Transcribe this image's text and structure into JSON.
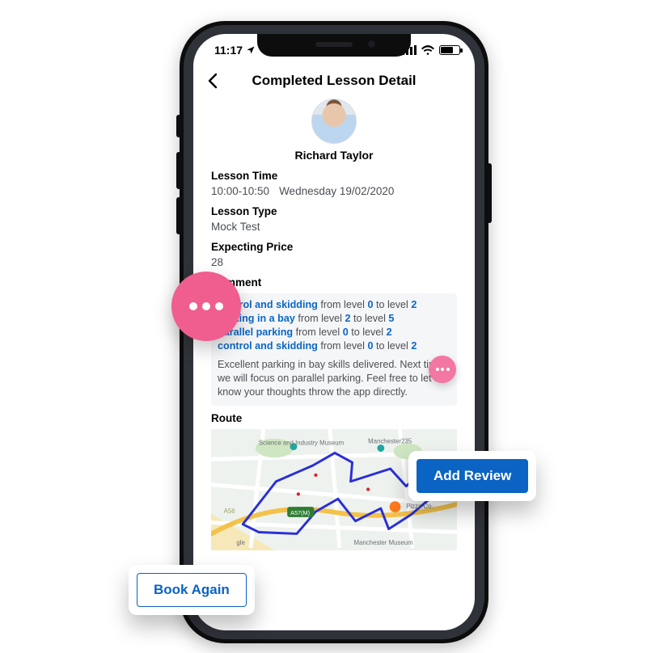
{
  "statusbar": {
    "time": "11:17"
  },
  "header": {
    "title": "Completed Lesson Detail"
  },
  "instructor": {
    "name": "Richard Taylor"
  },
  "labels": {
    "lesson_time": "Lesson Time",
    "lesson_type": "Lesson Type",
    "expecting_price": "Expecting Price",
    "comment": "Comment",
    "route": "Route"
  },
  "lesson": {
    "time_range": "10:00-10:50",
    "day_date": "Wednesday 19/02/2020",
    "type": "Mock Test",
    "price": "28"
  },
  "skills": [
    {
      "name": "control and skidding",
      "from": "0",
      "to": "2"
    },
    {
      "name": "parking in a bay",
      "from": "2",
      "to": "5"
    },
    {
      "name": "parallel parking",
      "from": "0",
      "to": "2"
    },
    {
      "name": "control and skidding",
      "from": "0",
      "to": "2"
    }
  ],
  "skill_words": {
    "from": "from level",
    "to": "to level"
  },
  "comment_text": "Excellent parking in bay skills delivered. Next time we will focus on parallel parking. Feel free to let me know your thoughts throw the app directly.",
  "map": {
    "labels": {
      "science": "Science and Industry Museum",
      "man235": "Manchester235",
      "pizza": "Pizza Co.",
      "museum": "Manchester Museum",
      "a57": "A57(M)",
      "a56": "A56",
      "gle": "gle"
    }
  },
  "cta": {
    "add_review": "Add Review",
    "book_again": "Book Again"
  },
  "colors": {
    "brand_blue": "#0b63c4",
    "bubble_pink": "#f05d8f"
  }
}
